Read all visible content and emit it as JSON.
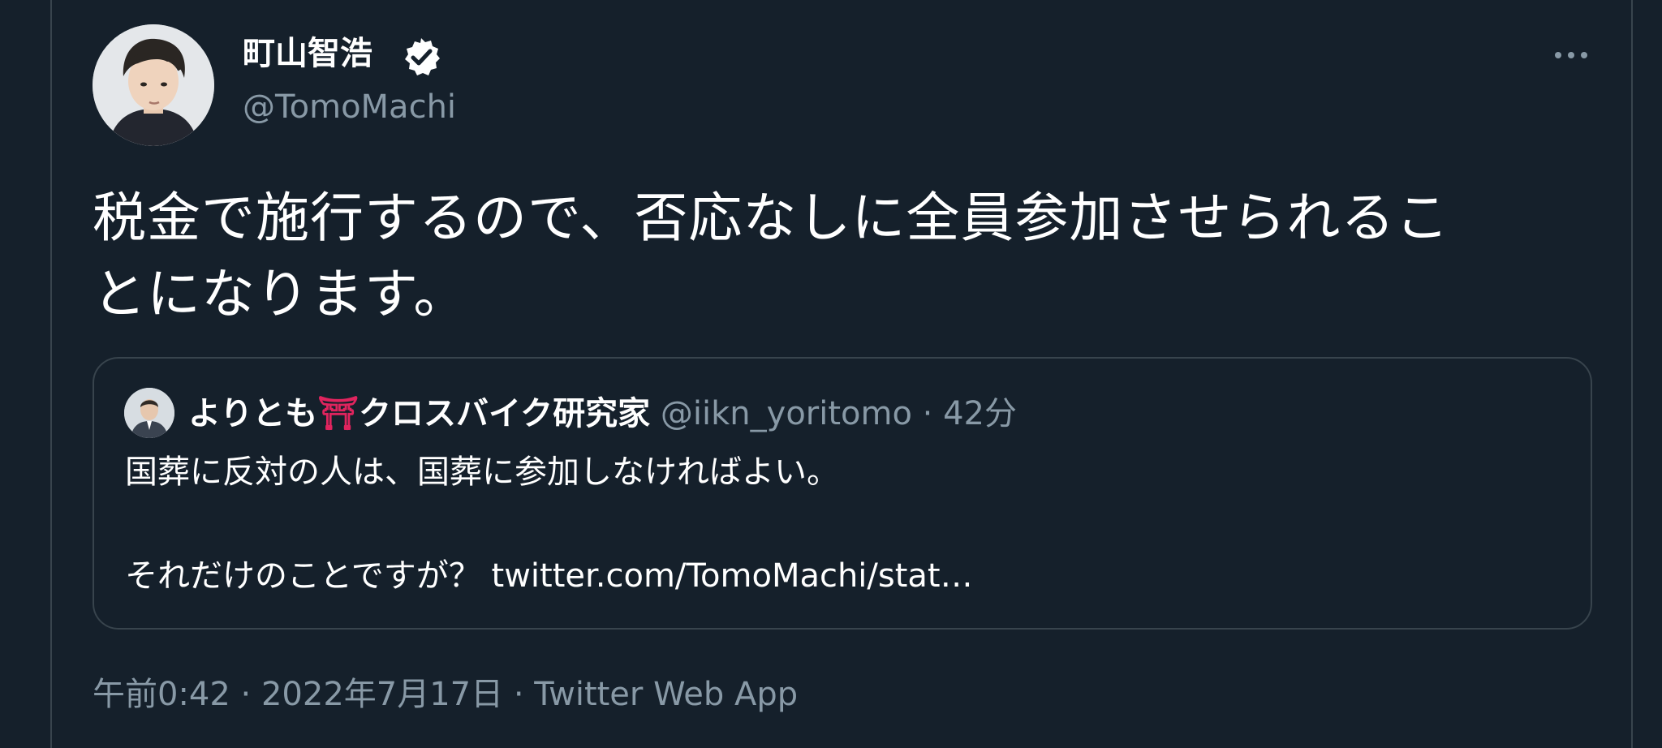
{
  "colors": {
    "background": "#15202b",
    "border": "#38444d",
    "primary_text": "#ffffff",
    "secondary_text": "#8899a6",
    "torii_accent": "#e0245e"
  },
  "author": {
    "display_name": "町山智浩",
    "handle": "@TomoMachi",
    "verified_icon": "verified-badge-icon",
    "avatar_icon": "avatar"
  },
  "more_icon": "more-options-icon",
  "tweet": {
    "line1": "税金で施行するので、否応なしに全員参加させられるこ",
    "line2": "とになります。"
  },
  "quote": {
    "avatar_icon": "avatar",
    "display_name_before": "よりとも",
    "display_name_emoji": "⛩",
    "display_name_after": "クロスバイク研究家",
    "handle": "@iikn_yoritomo",
    "separator": "·",
    "time": "42分",
    "line1": "国葬に反対の人は、国葬に参加しなければよい。",
    "line2": "それだけのことですが？ twitter.com/TomoMachi/stat…"
  },
  "meta": {
    "time": "午前0:42",
    "sep1": "·",
    "date": "2022年7月17日",
    "sep2": "·",
    "source": "Twitter Web App"
  }
}
